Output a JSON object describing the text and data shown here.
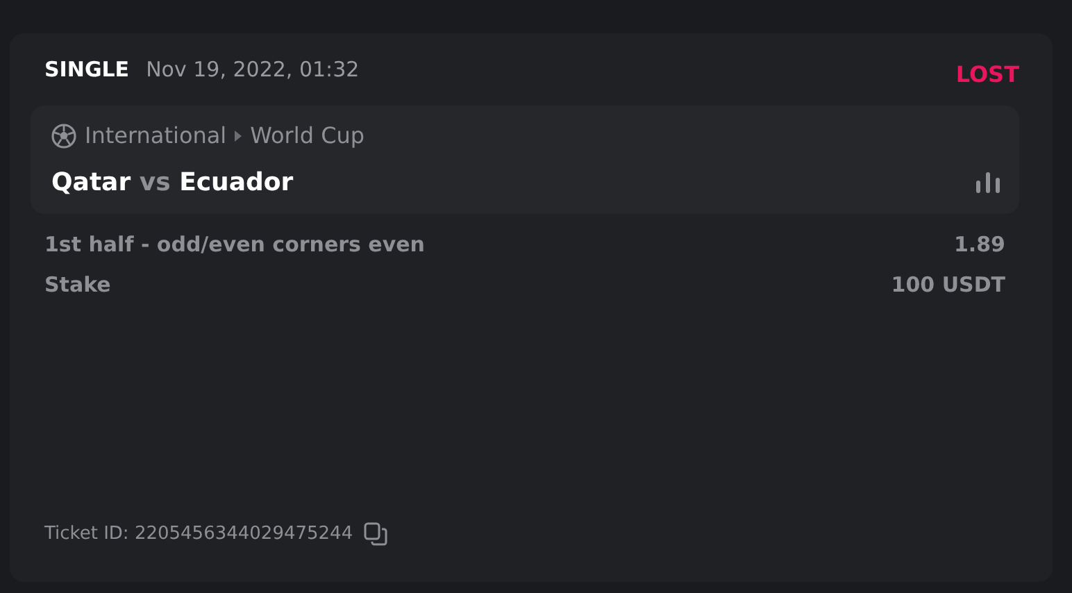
{
  "bet": {
    "type": "SINGLE",
    "date": "Nov 19, 2022, 01:32",
    "status": {
      "label": "LOST",
      "kind": "lost"
    }
  },
  "event": {
    "category": "International",
    "league": "World Cup",
    "home": "Qatar",
    "vs": "vs",
    "away": "Ecuador"
  },
  "details": [
    {
      "label": "1st half - odd/even corners even",
      "value": "1.89"
    },
    {
      "label": "Stake",
      "value": "100 USDT"
    }
  ],
  "ticket": {
    "label": "Ticket ID: 2205456344029475244"
  }
}
